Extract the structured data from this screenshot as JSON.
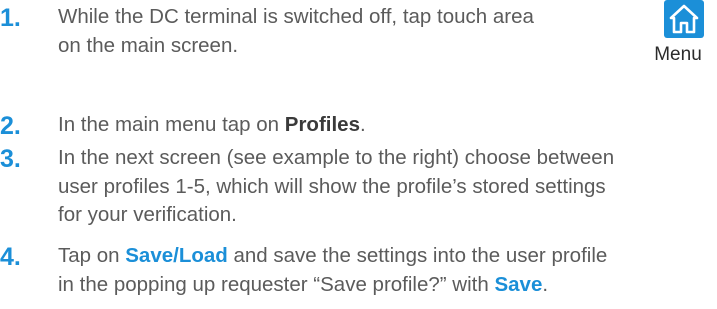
{
  "steps": [
    {
      "number": "1.",
      "line1": "While the DC terminal is switched off, tap touch area",
      "line2": "on the main screen."
    },
    {
      "number": "2.",
      "prefix": "In the main menu tap on ",
      "bold": "Profiles",
      "suffix": "."
    },
    {
      "number": "3.",
      "line1": "In the next screen (see example to the right) choose between",
      "line2": "user profiles 1-5, which will show the profile’s stored settings",
      "line3": "for your verification."
    },
    {
      "number": "4.",
      "line1_prefix": "Tap on ",
      "line1_bold": "Save/Load",
      "line1_suffix": " and save the settings into the user profile",
      "line2_prefix": "in the popping up requester “Save profile?” with ",
      "line2_bold": "Save",
      "line2_suffix": "."
    }
  ],
  "menu_button": {
    "icon": "home-icon",
    "label": "Menu",
    "color": "#1b8fd8"
  },
  "colors": {
    "accent": "#1b8fd8",
    "text": "#5b5b5b",
    "bold_text": "#3a3a3a"
  }
}
